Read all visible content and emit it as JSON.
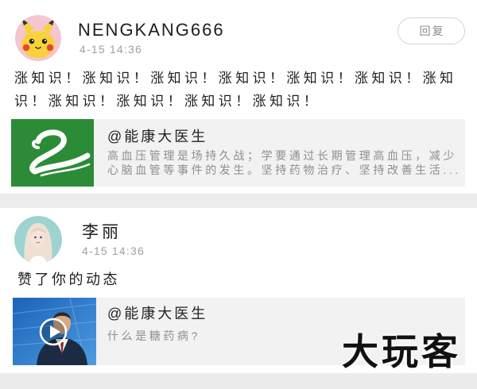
{
  "app": {
    "colors": {
      "page_bg": "#ececec",
      "card_bg": "#ffffff",
      "link_bg": "#f2f2f2",
      "brand_green": "#2c8b37",
      "video_blue": "#1b63b8",
      "secondary_text": "#a0a0a0"
    }
  },
  "feed": {
    "items": [
      {
        "user": {
          "name": "NENGKANG666",
          "avatar_icon": "pikachu-avatar"
        },
        "timestamp": "4-15 14:36",
        "reply_button": {
          "label": "回复"
        },
        "text": "涨知识！涨知识！涨知识！涨知识！涨知识！涨知识！涨知识！涨知识！涨知识！涨知识！涨知识！",
        "shared_link": {
          "title": "@能康大医生",
          "description": "高血压管理是场持久战；学要通过长期管理高血压，减少心脑血管等事件的发生。坚持药物治疗、坚持改善生活...",
          "thumbnail_icon": "brand-logo-icon"
        }
      },
      {
        "user": {
          "name": "李丽",
          "avatar_icon": "user-photo-avatar"
        },
        "timestamp": "4-15 14:36",
        "text": "赞了你的动态",
        "shared_link": {
          "title": "@能康大医生",
          "description": "什么是糖药病?",
          "thumbnail_icon": "video-thumbnail",
          "overlay_icon": "play-icon"
        }
      }
    ]
  },
  "watermark": {
    "text": "大玩客"
  }
}
